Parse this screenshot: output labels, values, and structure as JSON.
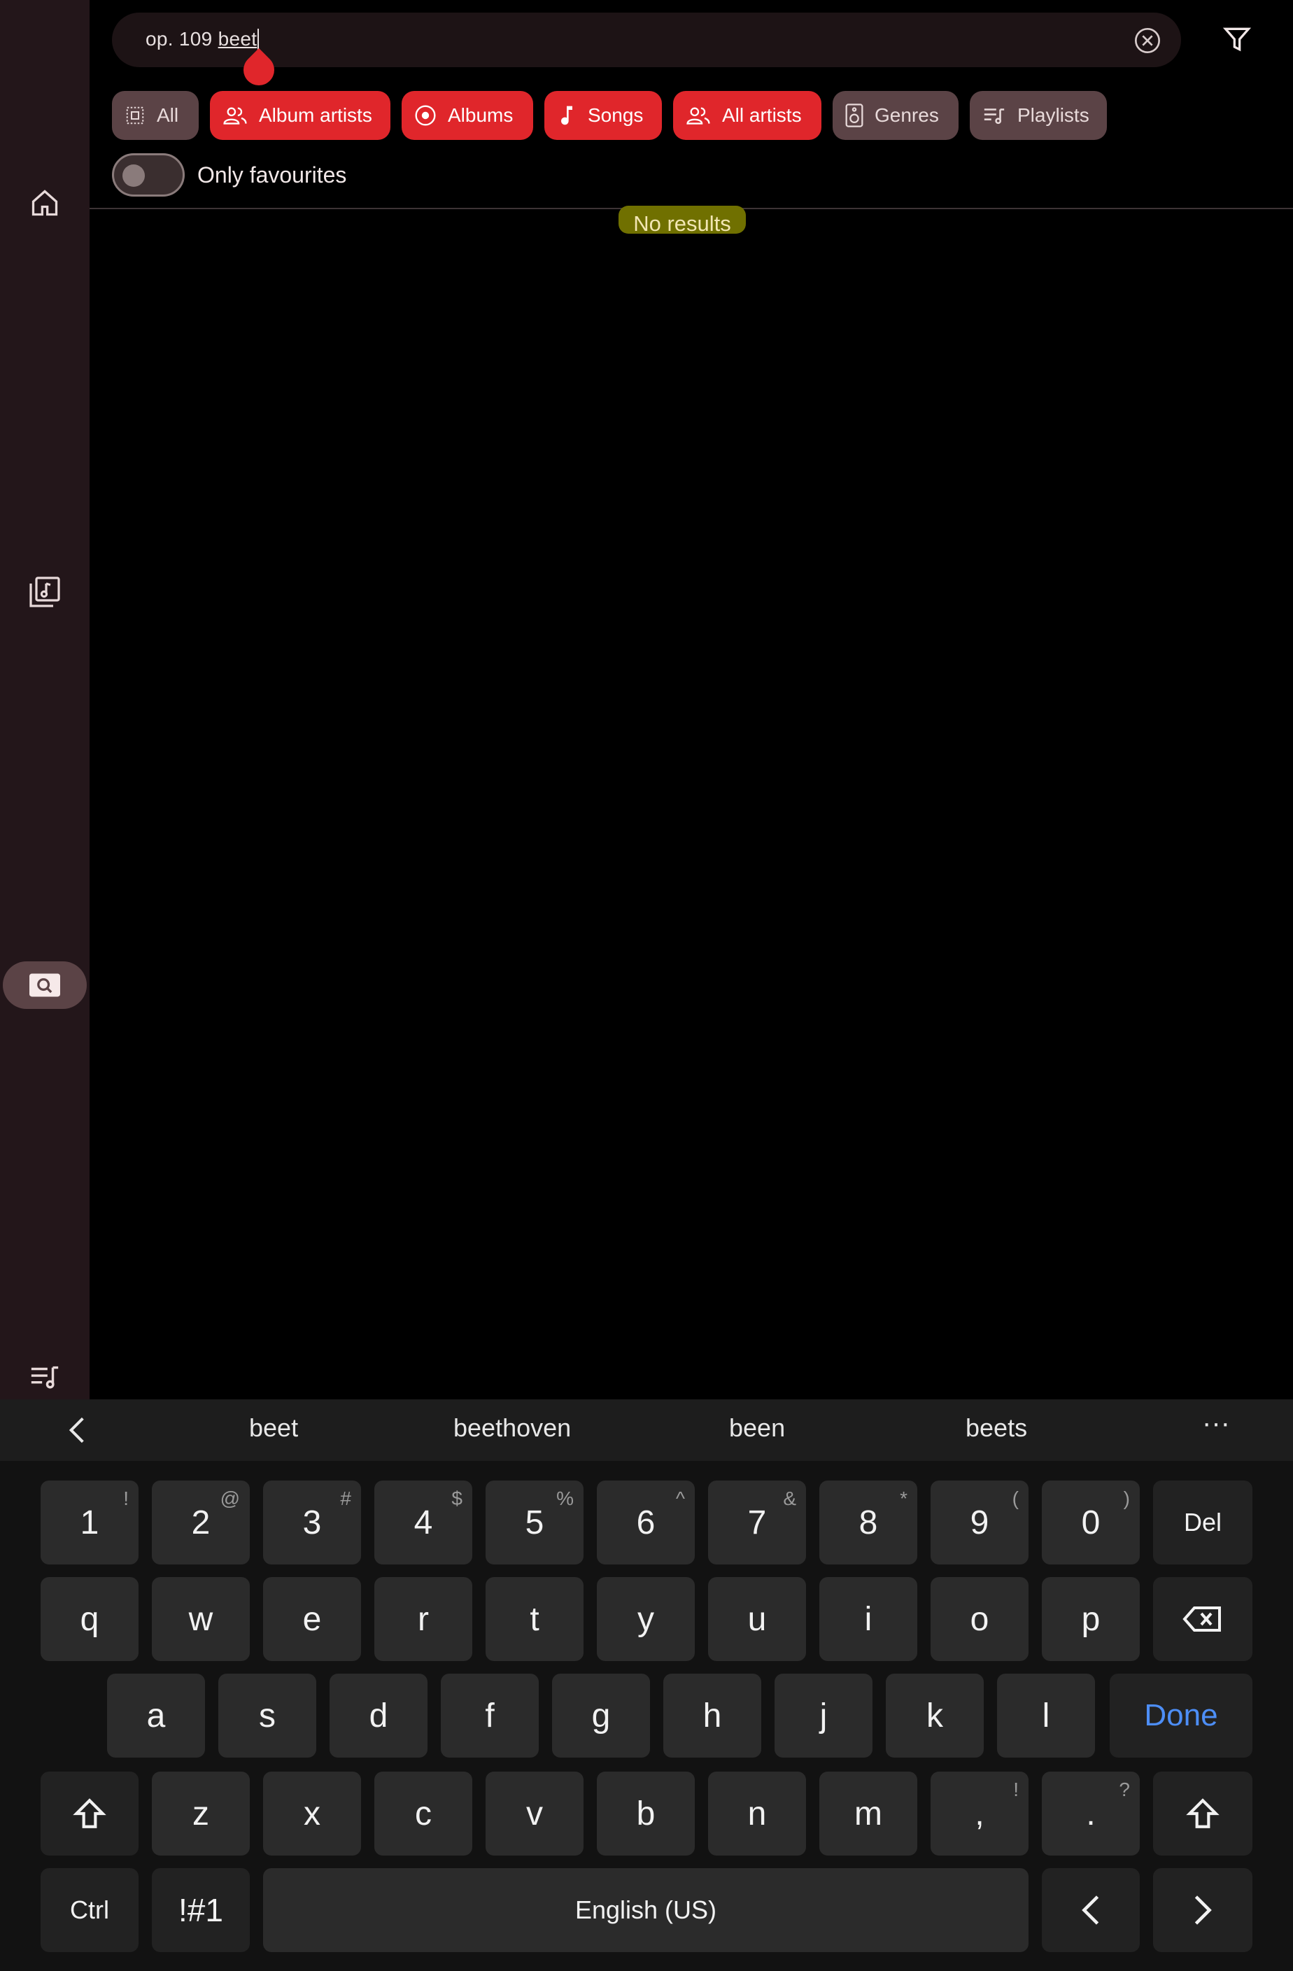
{
  "search": {
    "prefix": "op. 109 ",
    "composing": "beet",
    "clear_icon": "clear-circle-icon",
    "filter_icon": "filter-icon"
  },
  "sidebar": {
    "items": [
      {
        "name": "home",
        "icon": "home-icon"
      },
      {
        "name": "library",
        "icon": "music-library-icon"
      },
      {
        "name": "search",
        "icon": "search-icon",
        "active": true
      },
      {
        "name": "queue",
        "icon": "queue-music-icon"
      }
    ]
  },
  "chips": [
    {
      "label": "All",
      "icon": "select-all-icon",
      "selected": false
    },
    {
      "label": "Album artists",
      "icon": "people-icon",
      "selected": true
    },
    {
      "label": "Albums",
      "icon": "album-icon",
      "selected": true
    },
    {
      "label": "Songs",
      "icon": "music-note-icon",
      "selected": true
    },
    {
      "label": "All artists",
      "icon": "people-icon",
      "selected": true
    },
    {
      "label": "Genres",
      "icon": "speaker-icon",
      "selected": false
    },
    {
      "label": "Playlists",
      "icon": "playlist-icon",
      "selected": false
    }
  ],
  "favourites_toggle": {
    "label": "Only favourites",
    "on": false
  },
  "results": {
    "empty_text": "No results"
  },
  "keyboard": {
    "suggestions": [
      "beet",
      "beethoven",
      "been",
      "beets"
    ],
    "more": "···",
    "row1": [
      {
        "k": "1",
        "s": "!"
      },
      {
        "k": "2",
        "s": "@"
      },
      {
        "k": "3",
        "s": "#"
      },
      {
        "k": "4",
        "s": "$"
      },
      {
        "k": "5",
        "s": "%"
      },
      {
        "k": "6",
        "s": "^"
      },
      {
        "k": "7",
        "s": "&"
      },
      {
        "k": "8",
        "s": "*"
      },
      {
        "k": "9",
        "s": "("
      },
      {
        "k": "0",
        "s": ")"
      }
    ],
    "del": "Del",
    "row2": [
      "q",
      "w",
      "e",
      "r",
      "t",
      "y",
      "u",
      "i",
      "o",
      "p"
    ],
    "row3": [
      "a",
      "s",
      "d",
      "f",
      "g",
      "h",
      "j",
      "k",
      "l"
    ],
    "done": "Done",
    "row4": [
      "z",
      "x",
      "c",
      "v",
      "b",
      "n",
      "m"
    ],
    "comma": {
      "k": ",",
      "s": "!"
    },
    "period": {
      "k": ".",
      "s": "?"
    },
    "ctrl": "Ctrl",
    "symbols": "!#1",
    "space": "English (US)",
    "colors": {
      "accent": "#e0262b",
      "done": "#4d8ef6"
    }
  }
}
